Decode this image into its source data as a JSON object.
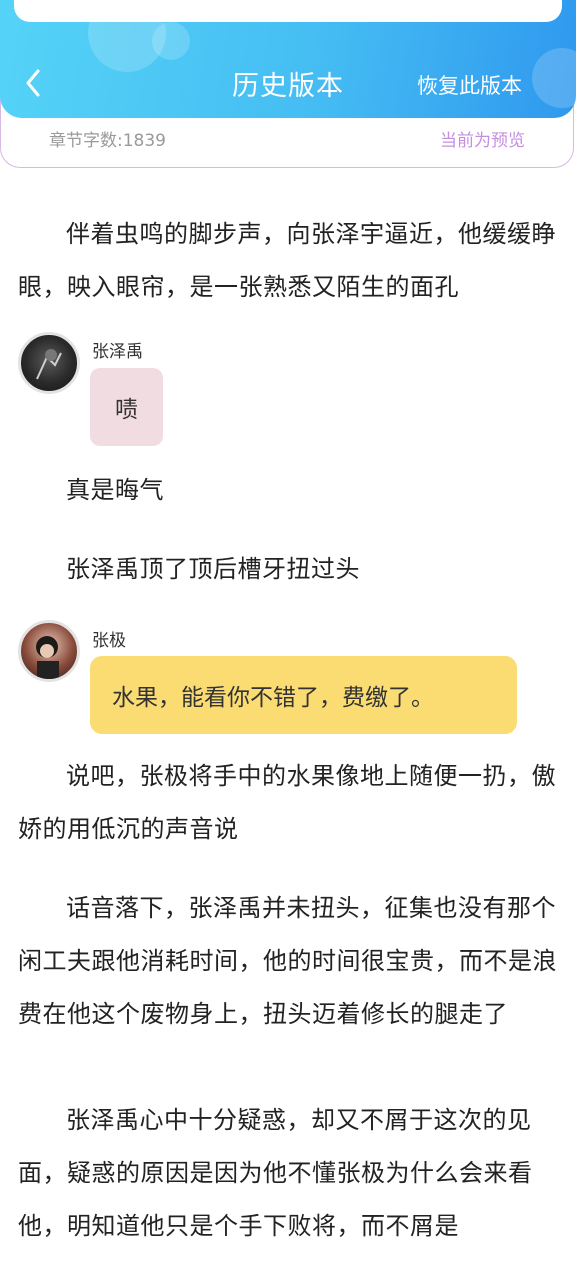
{
  "header": {
    "title": "历史版本",
    "restore_label": "恢复此版本"
  },
  "info_bar": {
    "word_count": "章节字数:1839",
    "preview_status": "当前为预览"
  },
  "content": {
    "para1": "伴着虫鸣的脚步声，向张泽宇逼近，他缓缓睁眼，映入眼帘，是一张熟悉又陌生的面孔",
    "chat1": {
      "speaker": "张泽禹",
      "message": "啧"
    },
    "para2": "真是晦气",
    "para3": "张泽禹顶了顶后槽牙扭过头",
    "chat2": {
      "speaker": "张极",
      "message": "水果，能看你不错了，费缴了。"
    },
    "para4": "说吧，张极将手中的水果像地上随便一扔，傲娇的用低沉的声音说",
    "para5": "话音落下，张泽禹并未扭头，征集也没有那个闲工夫跟他消耗时间，他的时间很宝贵，而不是浪费在他这个废物身上，扭头迈着修长的腿走了",
    "para6": "张泽禹心中十分疑惑，却又不屑于这次的见面，疑惑的原因是因为他不懂张极为什么会来看他，明知道他只是个手下败将，而不屑是"
  },
  "colors": {
    "header_start": "#55d3f7",
    "header_end": "#2f98ee",
    "preview": "#c58fe0",
    "bubble_pink": "#f1dde1",
    "bubble_yellow": "#fbdc72"
  }
}
